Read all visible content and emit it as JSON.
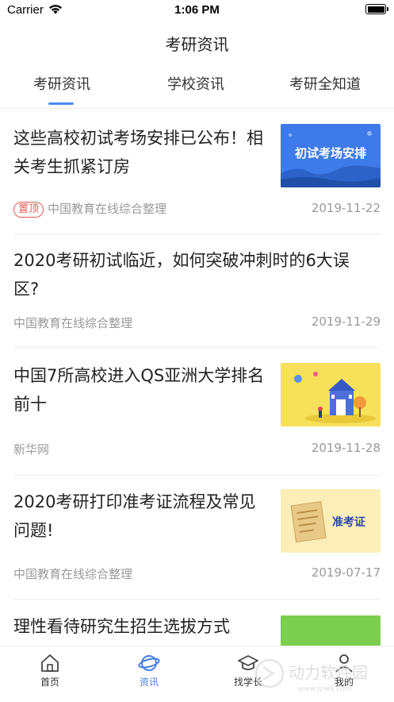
{
  "status_bar": {
    "carrier": "Carrier",
    "time": "1:06 PM"
  },
  "nav": {
    "title": "考研资讯"
  },
  "tabs": [
    {
      "label": "考研资讯",
      "active": true
    },
    {
      "label": "学校资讯",
      "active": false
    },
    {
      "label": "考研全知道",
      "active": false
    }
  ],
  "articles": [
    {
      "title": "这些高校初试考场安排已公布！相关考生抓紧订房",
      "pinned_label": "置顶",
      "source": "中国教育在线综合整理",
      "date": "2019-11-22",
      "thumb_text": "初试考场安排",
      "thumb_icon": "exam-room-banner"
    },
    {
      "title": "2020考研初试临近，如何突破冲刺时的6大误区?",
      "source": "中国教育在线综合整理",
      "date": "2019-11-29"
    },
    {
      "title": "中国7所高校进入QS亚洲大学排名前十",
      "source": "新华网",
      "date": "2019-11-28",
      "thumb_icon": "university-illustration"
    },
    {
      "title": "2020考研打印准考证流程及常见问题!",
      "source": "中国教育在线综合整理",
      "date": "2019-07-17",
      "thumb_text": "准考证",
      "thumb_icon": "admission-ticket-illustration"
    },
    {
      "title": "理性看待研究生招生选拔方式",
      "thumb_icon": "green-thumbnail"
    }
  ],
  "tabbar": [
    {
      "label": "首页",
      "icon": "home-icon",
      "active": false
    },
    {
      "label": "资讯",
      "icon": "planet-icon",
      "active": true
    },
    {
      "label": "找学长",
      "icon": "graduation-cap-icon",
      "active": false
    },
    {
      "label": "我的",
      "icon": "user-icon",
      "active": false
    }
  ],
  "watermark": {
    "text": "动力软件园",
    "sub": "www.jpw8.com"
  },
  "colors": {
    "accent": "#4a8cf0",
    "pin": "#e85a5a",
    "meta": "#9a9a9a"
  }
}
